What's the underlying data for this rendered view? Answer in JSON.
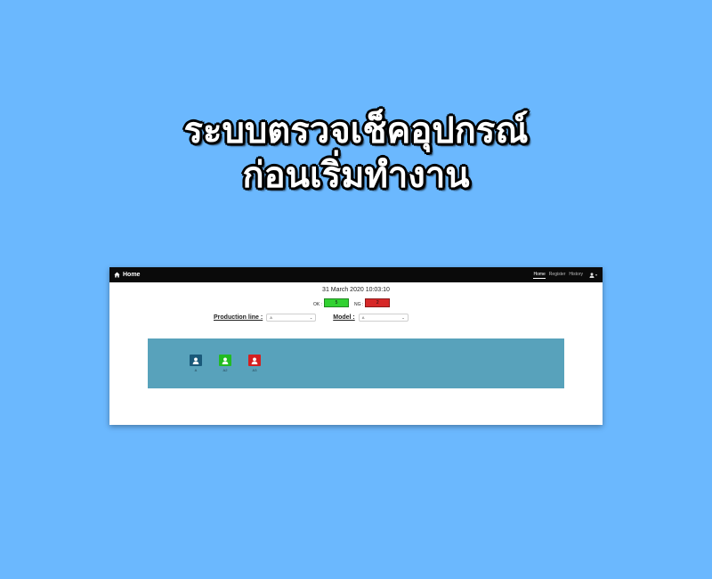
{
  "headline": {
    "line1": "ระบบตรวจเช็คอุปกรณ์",
    "line2": "ก่อนเริ่มทำงาน"
  },
  "navbar": {
    "brand": "Home",
    "brand_icon": "home-icon",
    "links": [
      {
        "label": "Home",
        "active": true
      },
      {
        "label": "Register",
        "active": false
      },
      {
        "label": "History",
        "active": false
      }
    ],
    "user_icon": "user-icon"
  },
  "datetime": "31 March 2020 10:03:10",
  "status": {
    "ok_label": "OK :",
    "ok_value": "5",
    "ok_color": "#31d131",
    "ng_label": "NG :",
    "ng_value": "2",
    "ng_color": "#d62828"
  },
  "filters": {
    "production_line_label": "Production line :",
    "production_line_value": "A",
    "model_label": "Model :",
    "model_value": "A"
  },
  "stations": [
    {
      "label": "A",
      "color": "#1a5a7a",
      "icon": "user-icon"
    },
    {
      "label": "A2",
      "color": "#22bb22",
      "icon": "user-icon"
    },
    {
      "label": "A3",
      "color": "#d42020",
      "icon": "user-icon"
    }
  ],
  "colors": {
    "background": "#6bb8fe",
    "panel": "#58a2bb",
    "navbar": "#0a0a0a"
  }
}
